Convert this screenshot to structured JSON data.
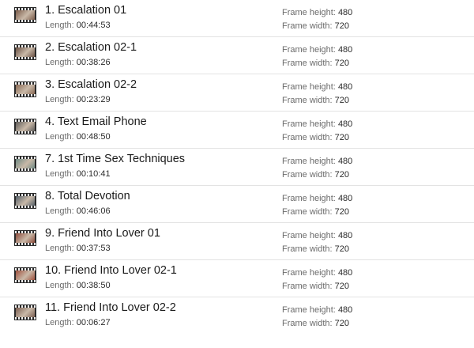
{
  "labels": {
    "length": "Length:",
    "frame_height": "Frame height:",
    "frame_width": "Frame width:"
  },
  "items": [
    {
      "title": "1. Escalation 01",
      "length": "00:44:53",
      "frame_height": "480",
      "frame_width": "720",
      "thumb_color": "#7a5a48"
    },
    {
      "title": "2. Escalation 02-1",
      "length": "00:38:26",
      "frame_height": "480",
      "frame_width": "720",
      "thumb_color": "#6a5144"
    },
    {
      "title": "3. Escalation 02-2",
      "length": "00:23:29",
      "frame_height": "480",
      "frame_width": "720",
      "thumb_color": "#8a6a55"
    },
    {
      "title": "4. Text Email Phone",
      "length": "00:48:50",
      "frame_height": "480",
      "frame_width": "720",
      "thumb_color": "#5d5a58"
    },
    {
      "title": "7. 1st Time Sex Techniques",
      "length": "00:10:41",
      "frame_height": "480",
      "frame_width": "720",
      "thumb_color": "#6f8a84"
    },
    {
      "title": "8. Total Devotion",
      "length": "00:46:06",
      "frame_height": "480",
      "frame_width": "720",
      "thumb_color": "#55606a"
    },
    {
      "title": "9. Friend Into Lover 01",
      "length": "00:37:53",
      "frame_height": "480",
      "frame_width": "720",
      "thumb_color": "#8b4a3a"
    },
    {
      "title": "10. Friend Into Lover 02-1",
      "length": "00:38:50",
      "frame_height": "480",
      "frame_width": "720",
      "thumb_color": "#a0503c"
    },
    {
      "title": "11. Friend Into Lover 02-2",
      "length": "00:06:27",
      "frame_height": "480",
      "frame_width": "720",
      "thumb_color": "#7c5f52"
    }
  ]
}
